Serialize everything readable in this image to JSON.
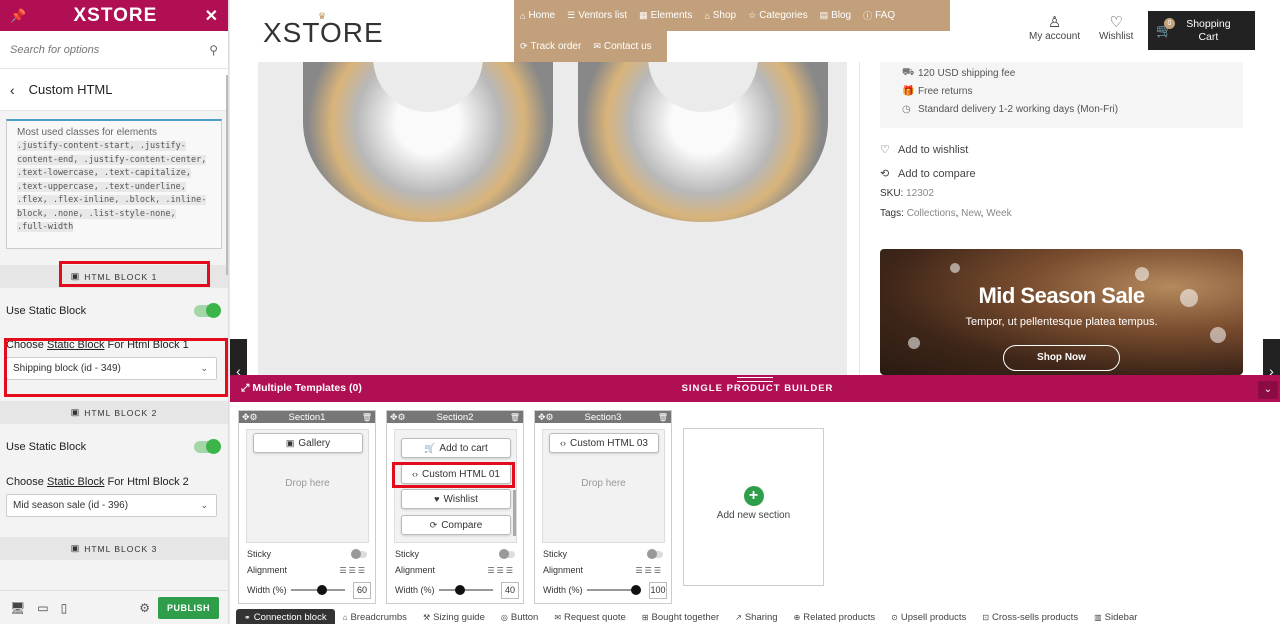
{
  "panel": {
    "logo": "XSTORE",
    "search_placeholder": "Search for options",
    "back_title": "Custom HTML",
    "classes_title": "Most used classes for elements",
    "classes": [
      ".justify-content-start, .justify-",
      "content-end, .justify-content-center,",
      ".text-lowercase, .text-capitalize,",
      ".text-uppercase, .text-underline,",
      ".flex, .flex-inline, .block, .inline-",
      "block, .none, .list-style-none,",
      ".full-width"
    ],
    "block1_heading": "HTML BLOCK 1",
    "block1_static_label": "Use Static Block",
    "block1_choose_pre": "Choose ",
    "block1_choose_link": "Static Block",
    "block1_choose_post": " For Html Block 1",
    "block1_select": "Shipping block (id - 349)",
    "block2_heading": "HTML BLOCK 2",
    "block2_static_label": "Use Static Block",
    "block2_choose_pre": "Choose ",
    "block2_choose_link": "Static Block",
    "block2_choose_post": " For Html Block 2",
    "block2_select": "Mid season sale (id - 396)",
    "block3_heading": "HTML BLOCK 3",
    "publish_label": "PUBLISH"
  },
  "header": {
    "logo": "XSTORE",
    "nav_row1": [
      {
        "icon": "home-icon",
        "label": "Home"
      },
      {
        "icon": "list-icon",
        "label": "Ventors list"
      },
      {
        "icon": "grid-icon",
        "label": "Elements"
      },
      {
        "icon": "shop-icon",
        "label": "Shop"
      },
      {
        "icon": "star-icon",
        "label": "Categories"
      },
      {
        "icon": "blog-icon",
        "label": "Blog"
      },
      {
        "icon": "info-icon",
        "label": "FAQ"
      }
    ],
    "nav_row2": [
      {
        "icon": "track-icon",
        "label": "Track order"
      },
      {
        "icon": "mail-icon",
        "label": "Contact us"
      }
    ],
    "account_label": "My account",
    "wishlist_label": "Wishlist",
    "cart_label_1": "Shopping",
    "cart_label_2": "Cart",
    "cart_count": "0"
  },
  "product": {
    "ship_lines": [
      "120 USD shipping fee",
      "Free returns",
      "Standard delivery 1-2 working days (Mon-Fri)"
    ],
    "add_wishlist": "Add to wishlist",
    "add_compare": "Add to compare",
    "sku_label": "SKU:",
    "sku_value": "12302",
    "tags_label": "Tags:",
    "tags": [
      "Collections",
      "New",
      "Week"
    ],
    "banner_title": "Mid Season Sale",
    "banner_sub": "Tempor, ut pellentesque platea tempus.",
    "banner_button": "Shop Now"
  },
  "builder": {
    "templates_label": "Multiple Templates (0)",
    "title": "SINGLE PRODUCT BUILDER",
    "sections": [
      {
        "name": "Section1",
        "elements": [
          "Gallery"
        ],
        "drop": "Drop here",
        "sticky": "Sticky",
        "alignment": "Alignment",
        "width_label": "Width (%)",
        "width": "60"
      },
      {
        "name": "Section2",
        "elements": [
          "Add to cart",
          "Custom HTML 01",
          "Wishlist",
          "Compare"
        ],
        "sticky": "Sticky",
        "alignment": "Alignment",
        "width_label": "Width (%)",
        "width": "40"
      },
      {
        "name": "Section3",
        "elements": [
          "Custom HTML 03"
        ],
        "drop": "Drop here",
        "sticky": "Sticky",
        "alignment": "Alignment",
        "width_label": "Width (%)",
        "width": "100"
      }
    ],
    "add_section": "Add new section",
    "tabs": [
      "Connection block",
      "Breadcrumbs",
      "Sizing guide",
      "Button",
      "Request quote",
      "Bought together",
      "Sharing",
      "Related products",
      "Upsell products",
      "Cross-sells products",
      "Sidebar"
    ]
  },
  "colors": {
    "brand": "#b00f54",
    "nav": "#c3a07c",
    "highlight": "#e30b1c",
    "publish": "#2e9e4b"
  }
}
